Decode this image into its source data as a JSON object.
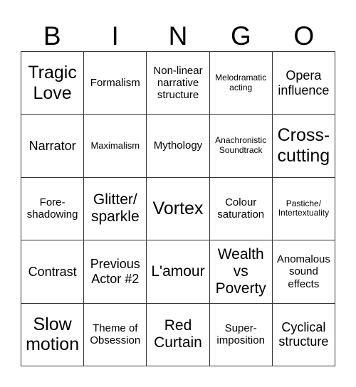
{
  "header": [
    "B",
    "I",
    "N",
    "G",
    "O"
  ],
  "cells": [
    {
      "text": "Tragic Love",
      "size": "xl"
    },
    {
      "text": "Formalism",
      "size": "sm"
    },
    {
      "text": "Non-linear narrative structure",
      "size": "sm"
    },
    {
      "text": "Melodramatic acting",
      "size": "xxs"
    },
    {
      "text": "Opera influence",
      "size": "m"
    },
    {
      "text": "Narrator",
      "size": "m"
    },
    {
      "text": "Maximalism",
      "size": "xs"
    },
    {
      "text": "Mythology",
      "size": "sm"
    },
    {
      "text": "Anachronistic Soundtrack",
      "size": "xxs"
    },
    {
      "text": "Cross-cutting",
      "size": "xl"
    },
    {
      "text": "Fore-shadowing",
      "size": "sm"
    },
    {
      "text": "Glitter/ sparkle",
      "size": "l"
    },
    {
      "text": "Vortex",
      "size": "xl"
    },
    {
      "text": "Colour saturation",
      "size": "sm"
    },
    {
      "text": "Pastiche/ Intertextuality",
      "size": "xxs"
    },
    {
      "text": "Contrast",
      "size": "m"
    },
    {
      "text": "Previous Actor #2",
      "size": "m"
    },
    {
      "text": "L'amour",
      "size": "l"
    },
    {
      "text": "Wealth vs Poverty",
      "size": "l"
    },
    {
      "text": "Anomalous sound effects",
      "size": "sm"
    },
    {
      "text": "Slow motion",
      "size": "xl"
    },
    {
      "text": "Theme of Obsession",
      "size": "sm"
    },
    {
      "text": "Red Curtain",
      "size": "l"
    },
    {
      "text": "Super-imposition",
      "size": "sm"
    },
    {
      "text": "Cyclical structure",
      "size": "m"
    }
  ]
}
